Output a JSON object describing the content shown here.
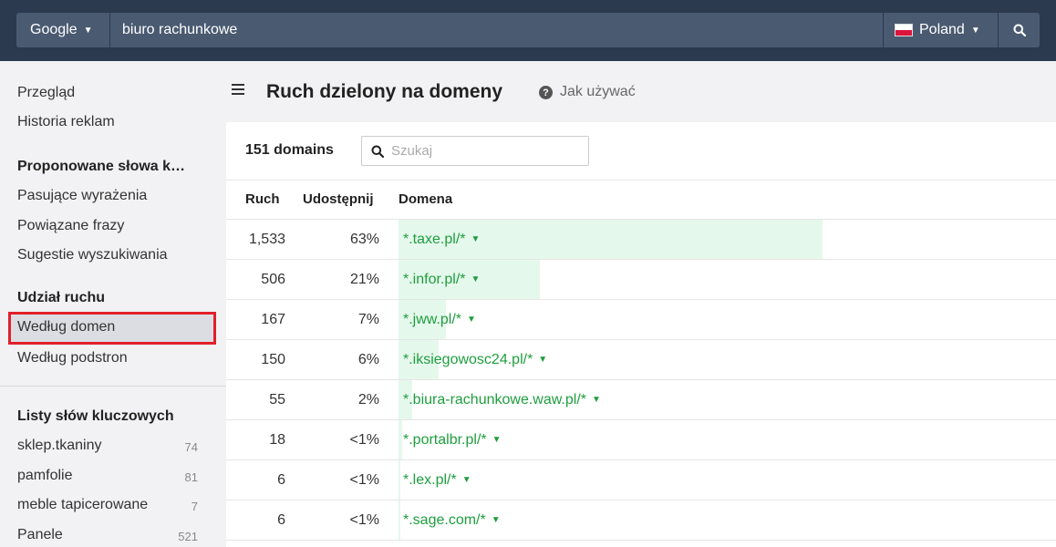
{
  "topbar": {
    "engine": "Google",
    "query": "biuro rachunkowe",
    "country": "Poland",
    "colors": {
      "bar": "#2b3a4e",
      "field": "#4a5a71"
    }
  },
  "sidebar": {
    "items_top": [
      "Przegląd",
      "Historia reklam"
    ],
    "section_keywords": {
      "title": "Proponowane słowa k…",
      "items": [
        "Pasujące wyrażenia",
        "Powiązane frazy",
        "Sugestie wyszukiwania"
      ]
    },
    "section_traffic": {
      "title": "Udział ruchu",
      "items": [
        "Według domen",
        "Według podstron"
      ]
    },
    "section_lists": {
      "title": "Listy słów kluczowych",
      "items": [
        {
          "label": "sklep.tkaniny",
          "count": "74"
        },
        {
          "label": "pamfolie",
          "count": "81"
        },
        {
          "label": "meble tapicerowane",
          "count": "7"
        },
        {
          "label": "Panele",
          "count": "521"
        }
      ]
    }
  },
  "main": {
    "title": "Ruch dzielony na domeny",
    "help_link": "Jak używać",
    "domain_count": "151 domains",
    "search_placeholder": "Szukaj",
    "columns": [
      "Ruch",
      "Udostępnij",
      "Domena"
    ],
    "rows": [
      {
        "traffic": "1,533",
        "share": "63%",
        "share_value": 63,
        "domain": "*.taxe.pl/*"
      },
      {
        "traffic": "506",
        "share": "21%",
        "share_value": 21,
        "domain": "*.infor.pl/*"
      },
      {
        "traffic": "167",
        "share": "7%",
        "share_value": 7,
        "domain": "*.jww.pl/*"
      },
      {
        "traffic": "150",
        "share": "6%",
        "share_value": 6,
        "domain": "*.iksiegowosc24.pl/*"
      },
      {
        "traffic": "55",
        "share": "2%",
        "share_value": 2,
        "domain": "*.biura-rachunkowe.waw.pl/*"
      },
      {
        "traffic": "18",
        "share": "<1%",
        "share_value": 0.5,
        "domain": "*.portalbr.pl/*"
      },
      {
        "traffic": "6",
        "share": "<1%",
        "share_value": 0.2,
        "domain": "*.lex.pl/*"
      },
      {
        "traffic": "6",
        "share": "<1%",
        "share_value": 0.2,
        "domain": "*.sage.com/*"
      }
    ]
  }
}
